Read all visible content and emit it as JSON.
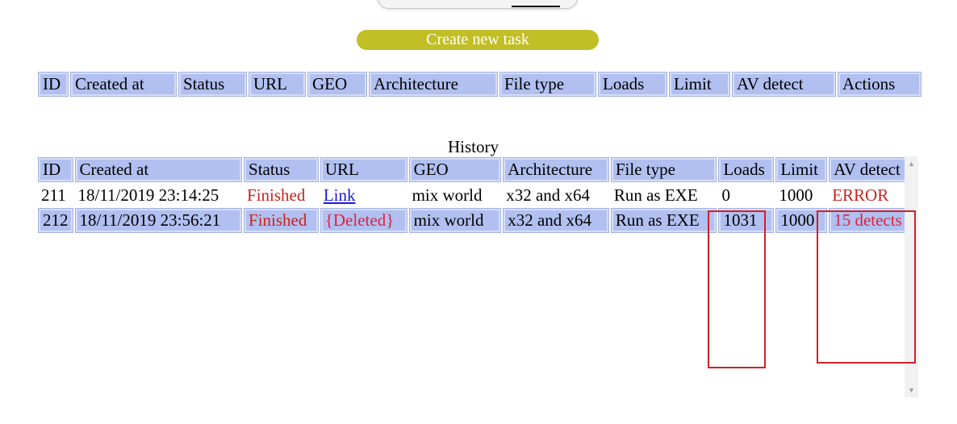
{
  "create_button": "Create new task",
  "tasks_table": {
    "headers": [
      "ID",
      "Created at",
      "Status",
      "URL",
      "GEO",
      "Architecture",
      "File type",
      "Loads",
      "Limit",
      "AV detect",
      "Actions"
    ]
  },
  "history": {
    "title": "History",
    "headers": [
      "ID",
      "Created at",
      "Status",
      "URL",
      "GEO",
      "Architecture",
      "File type",
      "Loads",
      "Limit",
      "AV detect"
    ],
    "rows": [
      {
        "id": "211",
        "created": "18/11/2019 23:14:25",
        "status": "Finished",
        "url": "Link",
        "geo": "mix world",
        "arch": "x32 and x64",
        "file_type": "Run as EXE",
        "loads": "0",
        "limit": "1000",
        "av": "ERROR"
      },
      {
        "id": "212",
        "created": "18/11/2019 23:56:21",
        "status": "Finished",
        "url": "{Deleted}",
        "geo": "mix world",
        "arch": "x32 and x64",
        "file_type": "Run as EXE",
        "loads": "1031",
        "limit": "1000",
        "av": "15 detects"
      }
    ]
  },
  "colors": {
    "header_bg": "#b1c0f0",
    "button_bg": "#c1be26",
    "status_red": "#c8231c",
    "deleted_red": "#e0203c",
    "link_blue": "#1b1bd8",
    "annotation_red": "#d0202a"
  }
}
